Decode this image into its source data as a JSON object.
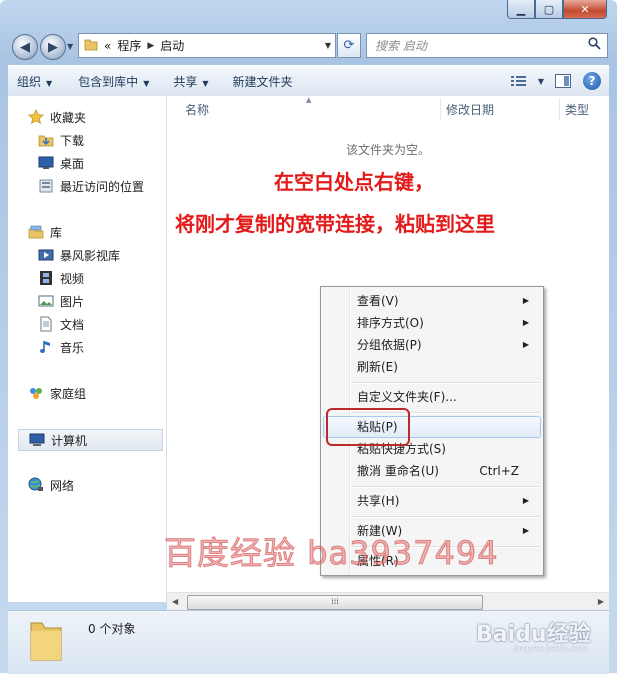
{
  "address": {
    "overflow": "«",
    "crumbs": [
      "程序",
      "启动"
    ]
  },
  "search": {
    "placeholder": "搜索 启动"
  },
  "toolbar": {
    "organize": "组织",
    "include_in_library": "包含到库中",
    "share": "共享",
    "new_folder": "新建文件夹"
  },
  "nav": {
    "favorites": "收藏夹",
    "downloads": "下载",
    "desktop": "桌面",
    "recent": "最近访问的位置",
    "libraries": "库",
    "storm_video": "暴风影视库",
    "videos": "视频",
    "pictures": "图片",
    "documents": "文档",
    "music": "音乐",
    "homegroup": "家庭组",
    "computer": "计算机",
    "network": "网络"
  },
  "columns": {
    "name": "名称",
    "date_modified": "修改日期",
    "type": "类型"
  },
  "content": {
    "empty_message": "该文件夹为空。"
  },
  "annotation": {
    "line1": "在空白处点右键，",
    "line2": "将刚才复制的宽带连接，粘贴到这里"
  },
  "context_menu": {
    "view": "查看(V)",
    "sort_by": "排序方式(O)",
    "group_by": "分组依据(P)",
    "refresh": "刷新(E)",
    "customize": "自定义文件夹(F)...",
    "paste": "粘贴(P)",
    "paste_shortcut": "粘贴快捷方式(S)",
    "undo_rename": "撤消 重命名(U)",
    "undo_shortcut": "Ctrl+Z",
    "share": "共享(H)",
    "new": "新建(W)",
    "properties": "属性(R)"
  },
  "status": {
    "item_count": "0 个对象"
  },
  "watermark": {
    "text": "百度经验 ba3937494",
    "baidu_logo": "Baidu经验",
    "baidu_url": "jingyan.baidu.com"
  },
  "colors": {
    "annotation_red": "#e41a1a",
    "highlight_box": "#c0282a",
    "window_frame": "#bfd6ee"
  }
}
